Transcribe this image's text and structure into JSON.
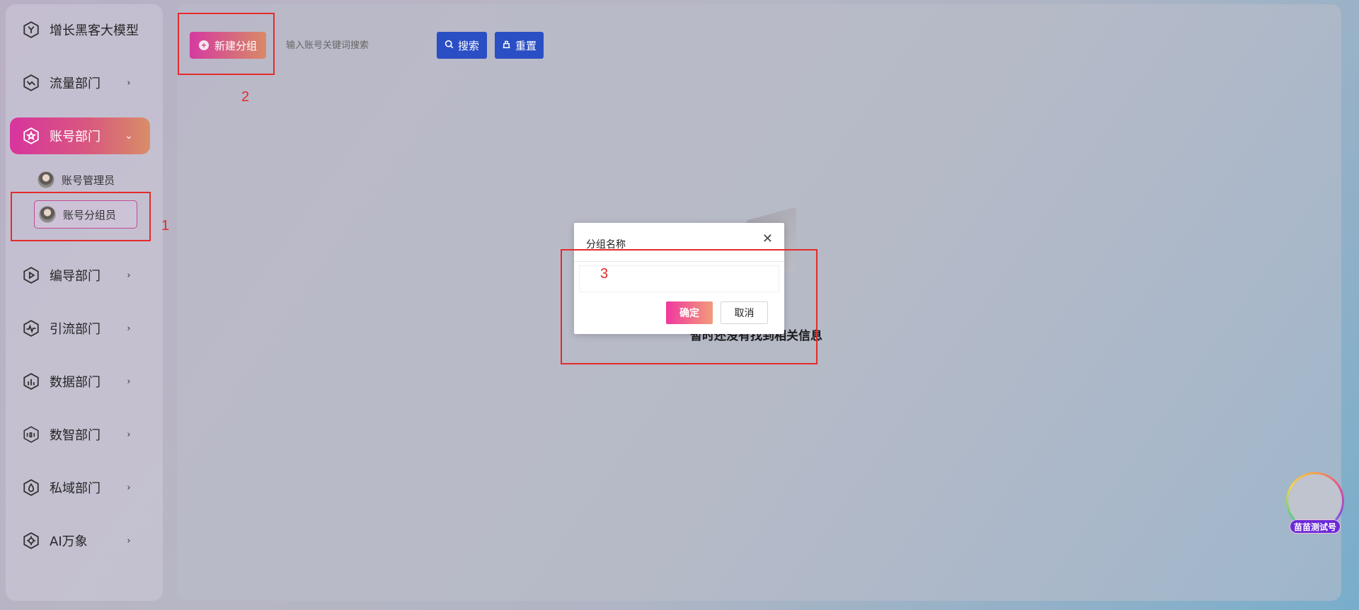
{
  "sidebar": {
    "brand": {
      "label": "增长黑客大模型",
      "icon": "hexagon-y-icon"
    },
    "items": [
      {
        "label": "流量部门",
        "icon": "flow-icon",
        "chevron": "›"
      },
      {
        "label": "账号部门",
        "icon": "pentagon-star-icon",
        "chevron": "⌄",
        "active": true
      },
      {
        "label": "编导部门",
        "icon": "play-icon",
        "chevron": "›"
      },
      {
        "label": "引流部门",
        "icon": "pulse-icon",
        "chevron": "›"
      },
      {
        "label": "数据部门",
        "icon": "bar-chart-icon",
        "chevron": "›"
      },
      {
        "label": "数智部门",
        "icon": "binary-icon",
        "chevron": "›"
      },
      {
        "label": "私域部门",
        "icon": "drop-icon",
        "chevron": "›"
      },
      {
        "label": "AI万象",
        "icon": "ai-icon",
        "chevron": "›"
      }
    ],
    "subitems": [
      {
        "label": "账号管理员"
      },
      {
        "label": "账号分组员",
        "selected": true
      }
    ]
  },
  "toolbar": {
    "new_group_label": "新建分组",
    "search_placeholder": "输入账号关键词搜索",
    "search_label": "搜索",
    "reset_label": "重置"
  },
  "empty_state": {
    "text": "暂时还没有找到相关信息"
  },
  "dialog": {
    "title": "分组名称",
    "input_value": "",
    "ok_label": "确定",
    "cancel_label": "取消"
  },
  "annotations": {
    "a1": "1",
    "a2": "2",
    "a3": "3"
  },
  "floating_user": {
    "name": "苗苗测试号"
  },
  "colors": {
    "active_gradient": [
      "#d8349e",
      "#d88e67"
    ],
    "primary_blue": "#2a4ec4",
    "annotation_red": "#e42b2b"
  }
}
